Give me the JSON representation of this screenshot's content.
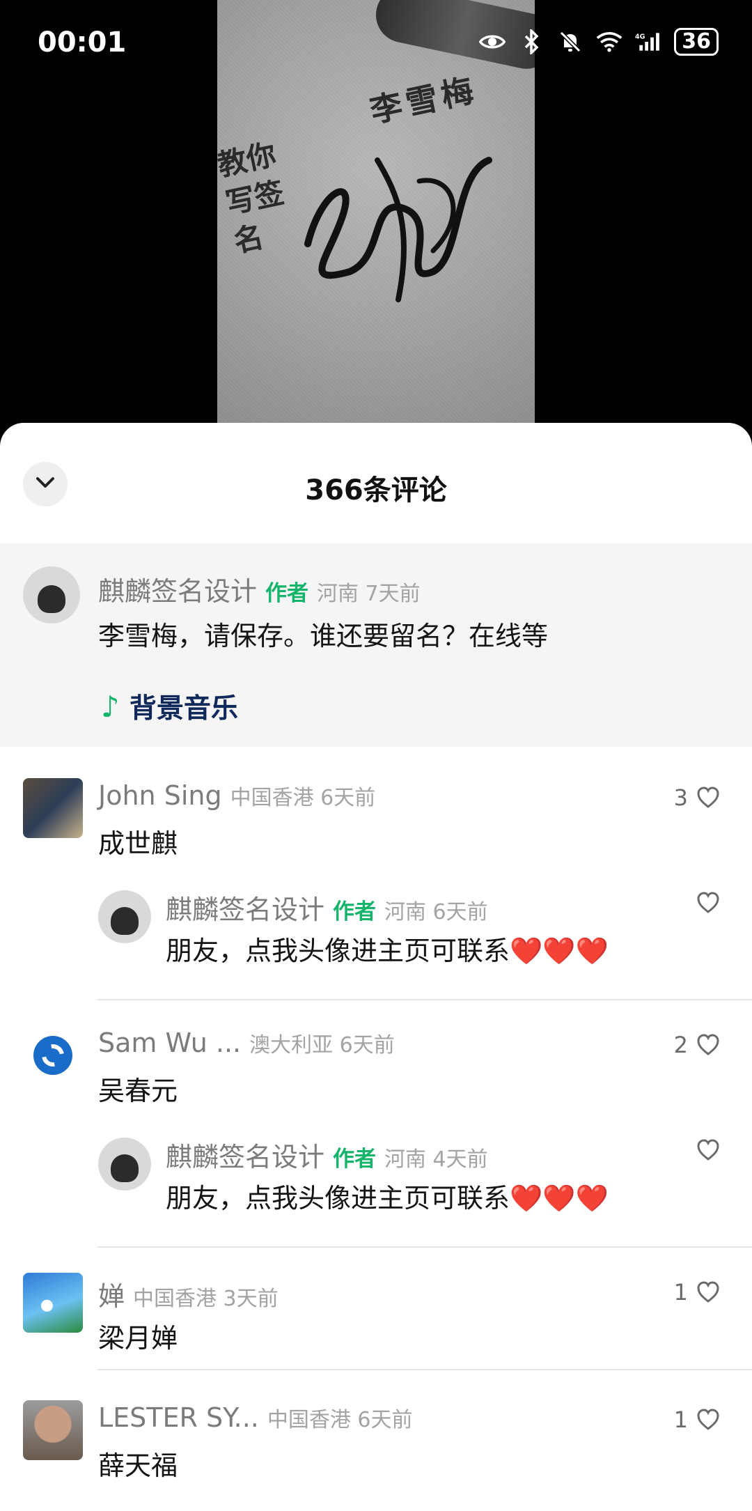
{
  "status_bar": {
    "time": "00:01",
    "battery": "36"
  },
  "video": {
    "overlay_name": "李雪梅",
    "overlay_subtitle": "教你写签名"
  },
  "sheet": {
    "title": "366条评论"
  },
  "pinned": {
    "name": "麒麟签名设计",
    "tag": "作者",
    "meta": "河南 7天前",
    "text": "李雪梅，请保存。谁还要留名？在线等",
    "music_label": "背景音乐"
  },
  "comments": [
    {
      "name": "John Sing",
      "meta": "中国香港 6天前",
      "text": "成世麒",
      "likes": "3",
      "reply": {
        "name": "麒麟签名设计",
        "tag": "作者",
        "meta": "河南 6天前",
        "text": "朋友，点我头像进主页可联系❤️❤️❤️"
      }
    },
    {
      "name": "Sam Wu ...",
      "meta": "澳大利亚 6天前",
      "text": "吴春元",
      "likes": "2",
      "reply": {
        "name": "麒麟签名设计",
        "tag": "作者",
        "meta": "河南 4天前",
        "text": "朋友，点我头像进主页可联系❤️❤️❤️"
      }
    },
    {
      "name": "婵",
      "meta": "中国香港 3天前",
      "text": "梁月婵",
      "likes": "1"
    },
    {
      "name": "LESTER  SY...",
      "meta": "中国香港 6天前",
      "text": "薛天福",
      "likes": "1"
    }
  ],
  "colors": {
    "author_tag": "#14b46b",
    "sheet_bg": "#ffffff",
    "pinned_bg": "#f5f5f5"
  },
  "icons": [
    "eye-icon",
    "bluetooth-icon",
    "mute-bell-icon",
    "wifi-icon",
    "signal-4g-icon",
    "battery-icon",
    "chevron-down-icon",
    "music-note-icon",
    "heart-outline-icon"
  ]
}
